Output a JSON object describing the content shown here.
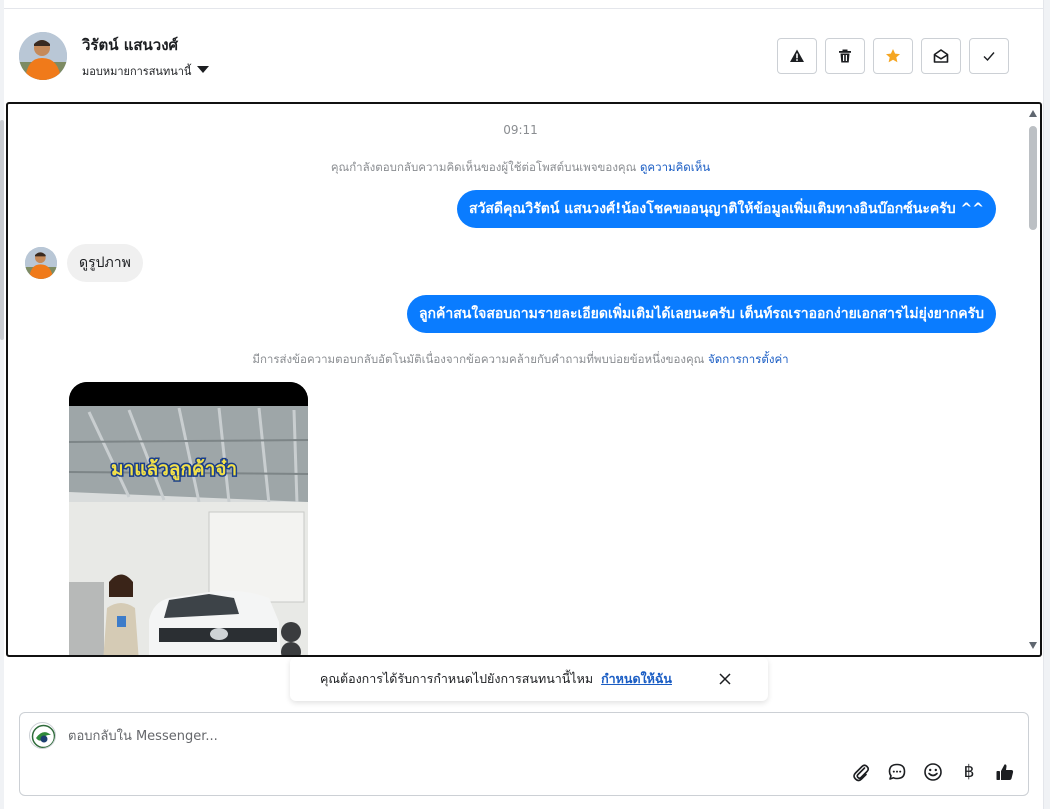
{
  "header": {
    "user_name": "วิรัตน์ แสนวงศ์",
    "assign_label": "มอบหมายการสนทนานี้",
    "actions": [
      {
        "id": "spam",
        "icon": "warning-icon"
      },
      {
        "id": "delete",
        "icon": "trash-icon"
      },
      {
        "id": "star",
        "icon": "star-icon"
      },
      {
        "id": "unread",
        "icon": "envelope-open-icon"
      },
      {
        "id": "done",
        "icon": "check-icon"
      }
    ],
    "star_color": "#f5a623"
  },
  "conversation": {
    "time": "09:11",
    "comment_note": {
      "text": "คุณกำลังตอบกลับความคิดเห็นของผู้ใช้ต่อโพสต์บนเพจของคุณ",
      "link": "ดูความคิดเห็น"
    },
    "messages": [
      {
        "direction": "out",
        "text": "สวัสดีคุณวิรัตน์ แสนวงศ์!น้องโชคขออนุญาติให้ข้อมูลเพิ่มเติมทางอินบ๊อกซ์นะครับ ^^"
      },
      {
        "direction": "in",
        "text": "ดูรูปภาพ"
      },
      {
        "direction": "out",
        "text": "ลูกค้าสนใจสอบถามรายละเอียดเพิ่มเติมได้เลยนะครับ เต็นท์รถเราออกง่ายเอกสารไม่ยุ่งยากครับ"
      }
    ],
    "auto_note": {
      "text": "มีการส่งข้อความตอบกลับอัตโนมัติเนื่องจากข้อความคล้ายกับคำถามที่พบบ่อยข้อหนึ่งของคุณ",
      "link": "จัดการการตั้งค่า"
    },
    "media_caption": "มาแล้วลูกค้าจ๋า"
  },
  "toast": {
    "text": "คุณต้องการได้รับการกำหนดไปยังการสนทนานี้ไหม",
    "link": "กำหนดให้ฉัน"
  },
  "composer": {
    "placeholder": "ตอบกลับใน Messenger...",
    "tools": [
      "paperclip-icon",
      "chat-bubble-icon",
      "emoji-icon",
      "baht-icon",
      "thumbs-up-icon"
    ],
    "baht_symbol": "฿"
  },
  "colors": {
    "outgoing_bubble": "#0a7cff",
    "incoming_bubble": "#f0f0f0",
    "link": "#1a5dc4"
  }
}
